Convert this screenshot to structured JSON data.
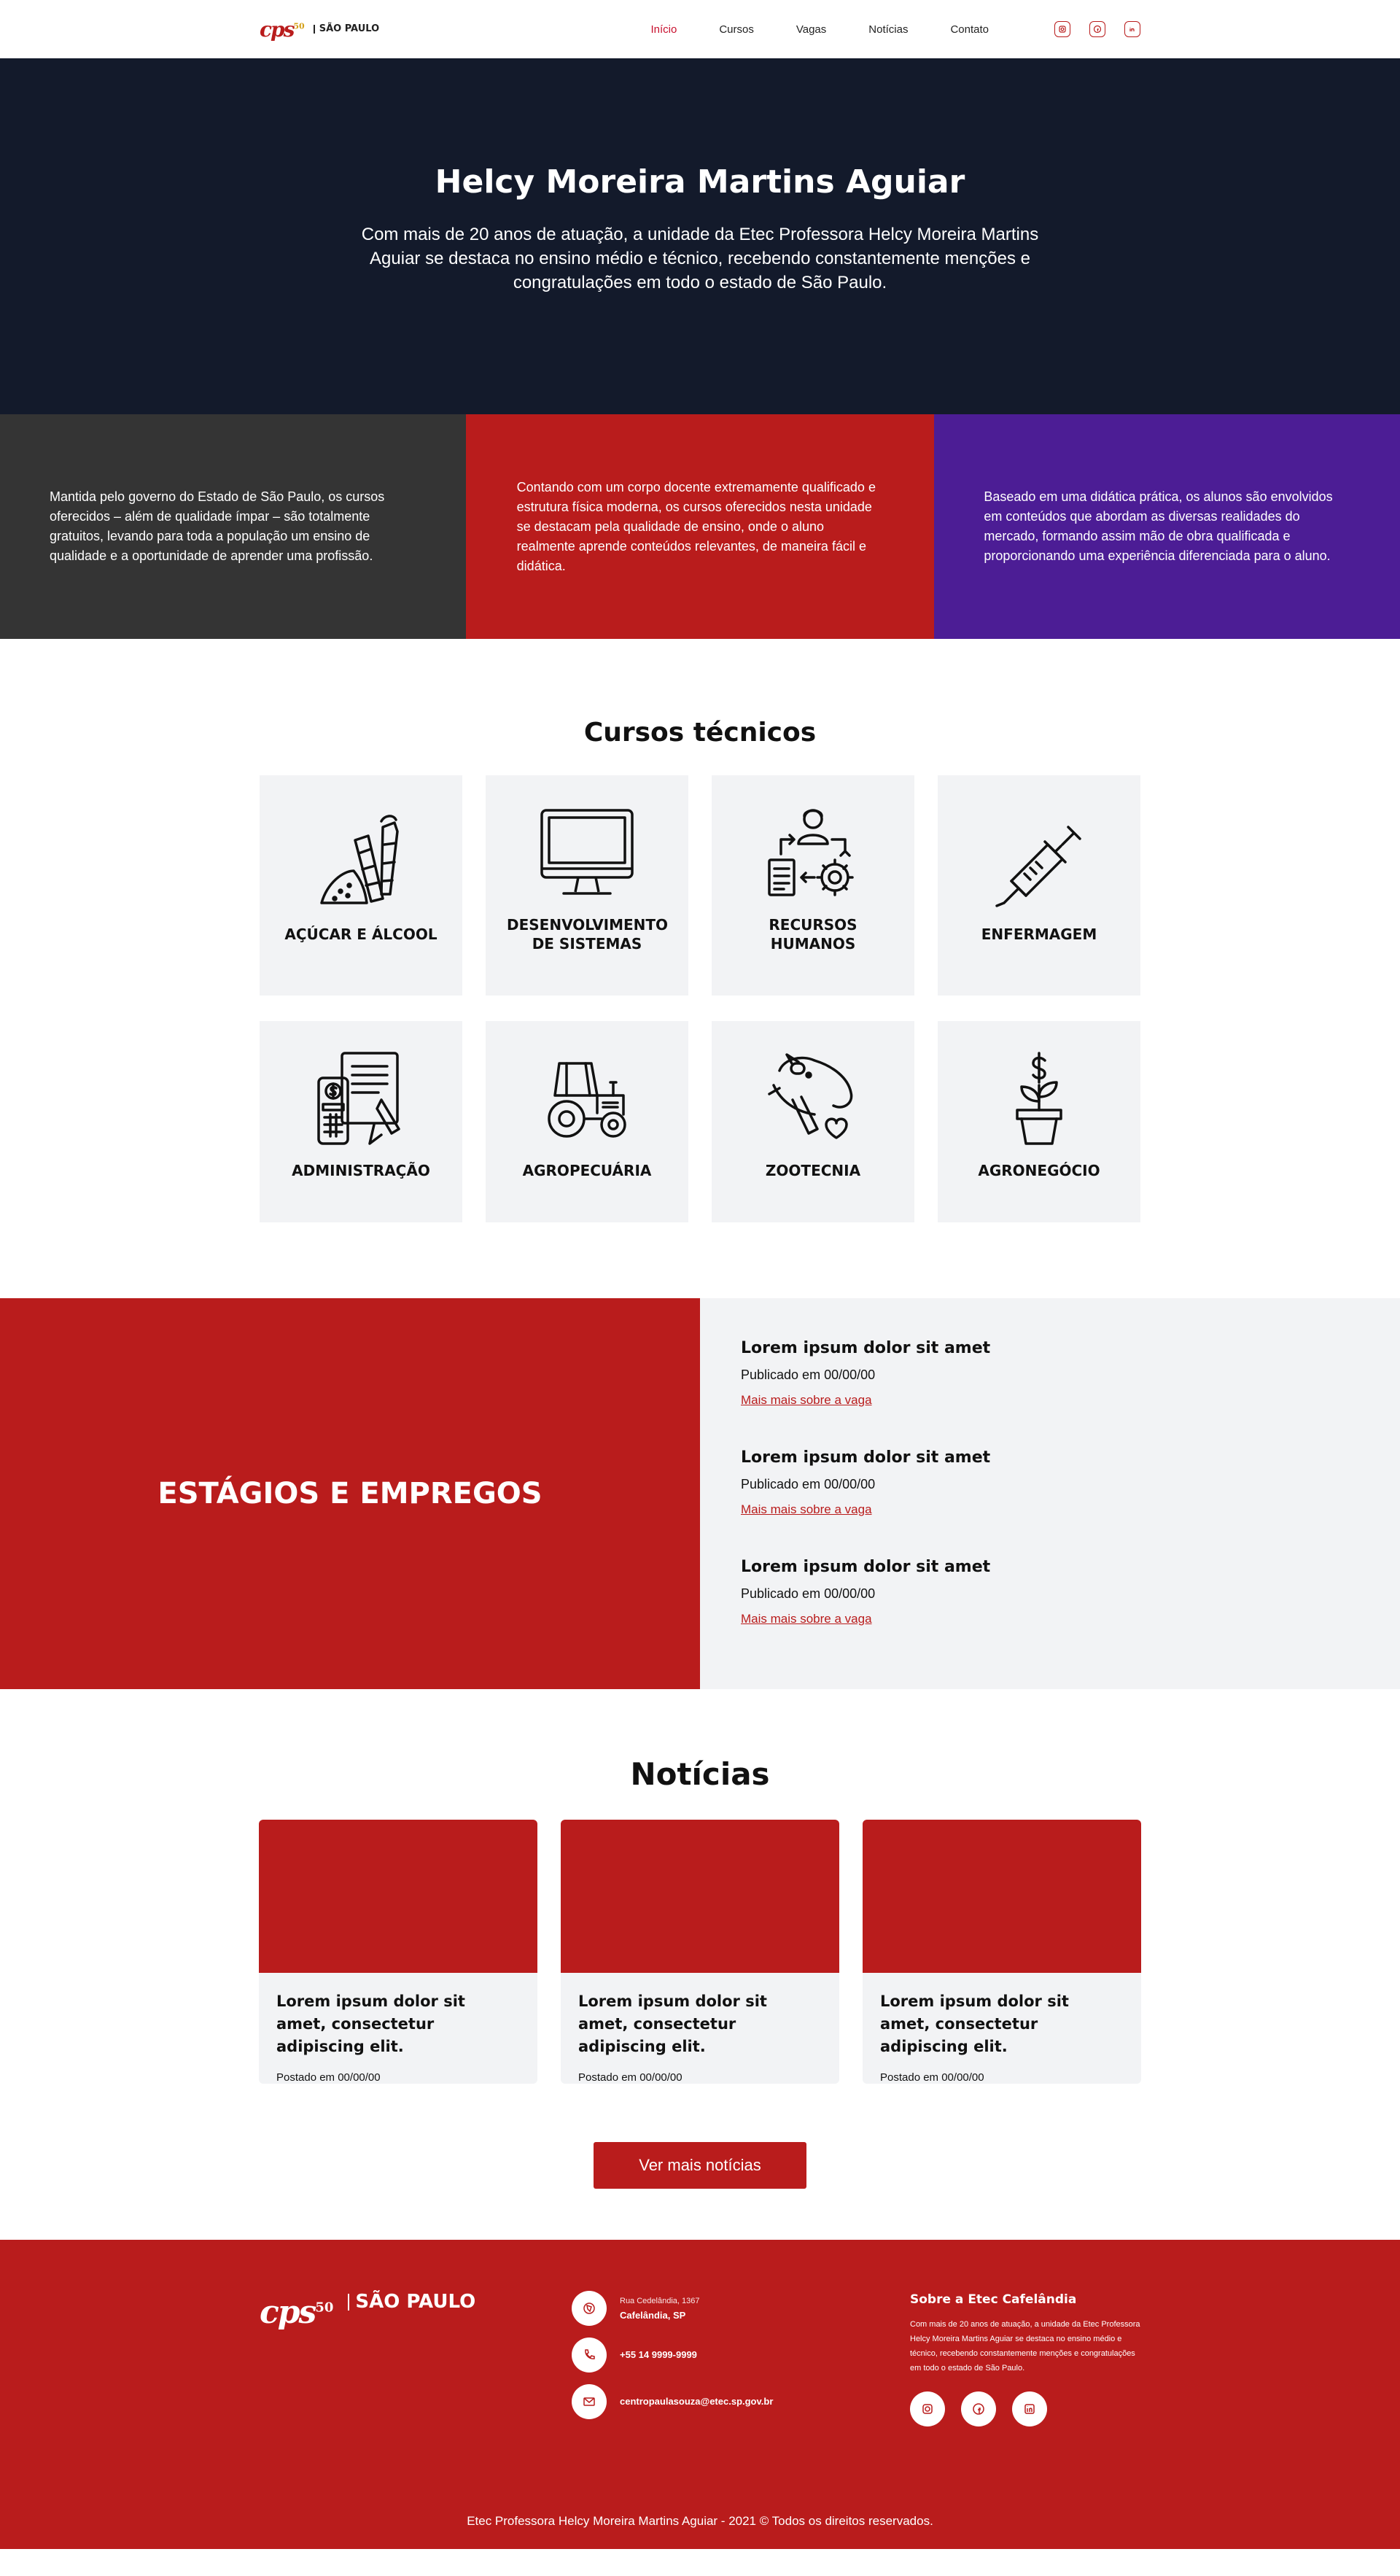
{
  "header": {
    "logo": {
      "cps": "cps",
      "cps_badge": "50",
      "sp": "SÃO PAULO"
    },
    "nav": [
      "Início",
      "Cursos",
      "Vagas",
      "Notícias",
      "Contato"
    ],
    "social_icons": [
      "instagram-icon",
      "facebook-icon",
      "linkedin-icon"
    ]
  },
  "hero": {
    "title": "Helcy Moreira Martins Aguiar",
    "subtitle": "Com mais de 20 anos de atuação, a unidade da Etec Professora Helcy Moreira Martins Aguiar se destaca no ensino médio e técnico, recebendo constantemente menções e congratulações em todo o estado de São Paulo."
  },
  "features": [
    "Mantida pelo governo do Estado de São Paulo, os cursos oferecidos – além de qualidade ímpar – são totalmente gratuitos, levando para toda a população um ensino de qualidade e a oportunidade de aprender uma profissão.",
    "Contando com um corpo docente extremamente qualificado e estrutura física moderna, os cursos oferecidos nesta unidade se destacam pela qualidade de ensino, onde o aluno realmente aprende conteúdos relevantes, de maneira fácil e didática.",
    "Baseado em uma didática prática, os alunos são envolvidos em conteúdos que abordam as diversas realidades do mercado, formando assim mão de obra qualificada e proporcionando uma experiência diferenciada para o aluno."
  ],
  "courses": {
    "title": "Cursos técnicos",
    "items": [
      {
        "label": "AÇÚCAR E ÁLCOOL",
        "icon": "sugarcane-icon"
      },
      {
        "label": "DESENVOLVIMENTO DE SISTEMAS",
        "icon": "monitor-icon"
      },
      {
        "label": "RECURSOS HUMANOS",
        "icon": "hr-icon"
      },
      {
        "label": "ENFERMAGEM",
        "icon": "syringe-icon"
      },
      {
        "label": "ADMINISTRAÇÃO",
        "icon": "administration-icon"
      },
      {
        "label": "AGROPECUÁRIA",
        "icon": "tractor-icon"
      },
      {
        "label": "ZOOTECNIA",
        "icon": "pig-icon"
      },
      {
        "label": "AGRONEGÓCIO",
        "icon": "plant-money-icon"
      }
    ]
  },
  "jobs": {
    "title": "ESTÁGIOS E EMPREGOS",
    "items": [
      {
        "title": "Lorem ipsum dolor sit amet",
        "date": "Publicado em 00/00/00",
        "link": "Mais mais sobre a vaga"
      },
      {
        "title": "Lorem ipsum dolor sit amet",
        "date": "Publicado em 00/00/00",
        "link": "Mais mais sobre a vaga"
      },
      {
        "title": "Lorem ipsum dolor sit amet",
        "date": "Publicado em 00/00/00",
        "link": "Mais mais sobre a vaga"
      }
    ]
  },
  "news": {
    "title": "Notícias",
    "items": [
      {
        "title": "Lorem ipsum dolor sit amet, consectetur adipiscing elit.",
        "date": "Postado em 00/00/00"
      },
      {
        "title": "Lorem ipsum dolor sit amet, consectetur adipiscing elit.",
        "date": "Postado em 00/00/00"
      },
      {
        "title": "Lorem ipsum dolor sit amet, consectetur adipiscing elit.",
        "date": "Postado em 00/00/00"
      }
    ],
    "button": "Ver mais notícias"
  },
  "footer": {
    "address_small": "Rua Cedelândia, 1367",
    "address": "Cafelândia, SP",
    "phone": "+55 14 9999-9999",
    "email": "centropaulasouza@etec.sp.gov.br",
    "about_title": "Sobre a Etec Cafelândia",
    "about_text": "Com mais de 20 anos de atuação, a unidade da Etec Professora Helcy Moreira Martins Aguiar se destaca no ensino médio e técnico, recebendo constantemente menções e congratulações em todo o estado de São Paulo.",
    "copyright": "Etec Professora Helcy Moreira Martins Aguiar - 2021 © Todos os direitos reservados."
  },
  "colors": {
    "brand_red": "#b91c1c",
    "hero_bg": "#131a2b",
    "feature_dark": "#343434",
    "feature_purple": "#4c1d95",
    "card_bg": "#f2f3f5"
  }
}
